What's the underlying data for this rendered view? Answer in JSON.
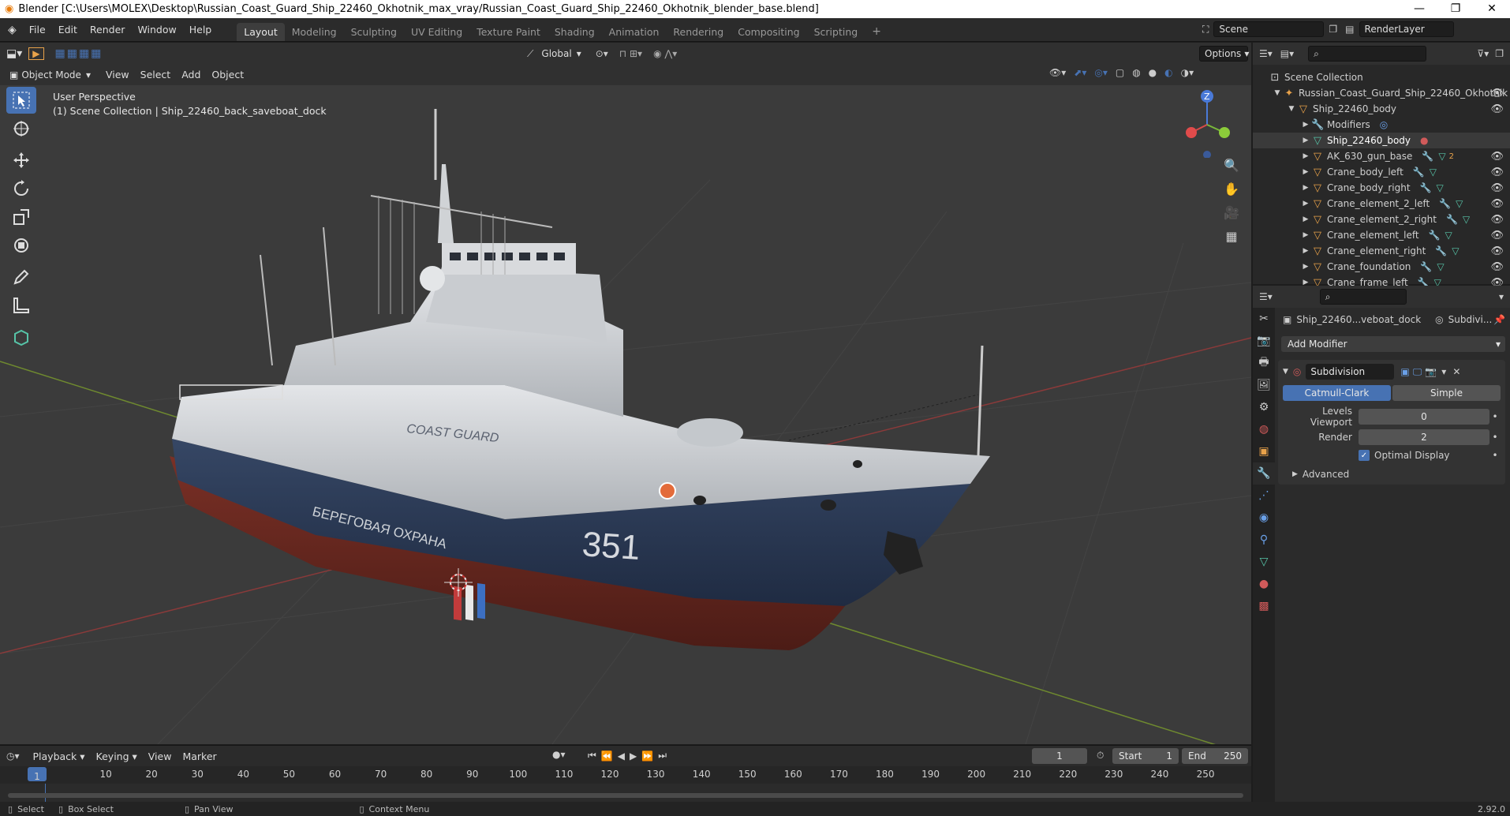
{
  "window": {
    "title": "Blender [C:\\Users\\MOLEX\\Desktop\\Russian_Coast_Guard_Ship_22460_Okhotnik_max_vray/Russian_Coast_Guard_Ship_22460_Okhotnik_blender_base.blend]",
    "min": "—",
    "max": "❐",
    "close": "✕"
  },
  "menu": [
    "File",
    "Edit",
    "Render",
    "Window",
    "Help"
  ],
  "workspaces": [
    "Layout",
    "Modeling",
    "Sculpting",
    "UV Editing",
    "Texture Paint",
    "Shading",
    "Animation",
    "Rendering",
    "Compositing",
    "Scripting"
  ],
  "scene": {
    "name": "Scene",
    "render_layer": "RenderLayer"
  },
  "viewport": {
    "mode": "Object Mode",
    "menus": [
      "View",
      "Select",
      "Add",
      "Object"
    ],
    "transform": "Global",
    "options": "Options",
    "perspective": "User Perspective",
    "collection_info": "(1) Scene Collection | Ship_22460_back_saveboat_dock",
    "hull_number": "351",
    "hull_text": "COAST GUARD",
    "side_text": "БЕРЕГОВАЯ ОХРАНА",
    "gizmo_z": "Z"
  },
  "outliner": {
    "root": "Scene Collection",
    "items": [
      {
        "label": "Russian_Coast_Guard_Ship_22460_Okhotnik",
        "depth": 1,
        "icon": "armature-icon",
        "color": "#e8a24a"
      },
      {
        "label": "Ship_22460_body",
        "depth": 2,
        "icon": "mesh-object-icon",
        "color": "#e8a24a"
      },
      {
        "label": "Modifiers",
        "depth": 3,
        "icon": "wrench-icon",
        "color": "#6aa0e8"
      },
      {
        "label": "Ship_22460_body",
        "depth": 3,
        "icon": "mesh-data-icon",
        "color": "#57c4a8"
      },
      {
        "label": "AK_630_gun_base",
        "depth": 3,
        "icon": "mesh-object-icon",
        "color": "#e8a24a"
      },
      {
        "label": "Crane_body_left",
        "depth": 3,
        "icon": "mesh-object-icon",
        "color": "#e8a24a"
      },
      {
        "label": "Crane_body_right",
        "depth": 3,
        "icon": "mesh-object-icon",
        "color": "#e8a24a"
      },
      {
        "label": "Crane_element_2_left",
        "depth": 3,
        "icon": "mesh-object-icon",
        "color": "#e8a24a"
      },
      {
        "label": "Crane_element_2_right",
        "depth": 3,
        "icon": "mesh-object-icon",
        "color": "#e8a24a"
      },
      {
        "label": "Crane_element_left",
        "depth": 3,
        "icon": "mesh-object-icon",
        "color": "#e8a24a"
      },
      {
        "label": "Crane_element_right",
        "depth": 3,
        "icon": "mesh-object-icon",
        "color": "#e8a24a"
      },
      {
        "label": "Crane_foundation",
        "depth": 3,
        "icon": "mesh-object-icon",
        "color": "#e8a24a"
      },
      {
        "label": "Crane_frame_left",
        "depth": 3,
        "icon": "mesh-object-icon",
        "color": "#e8a24a"
      }
    ],
    "gun_base_badge": "2"
  },
  "properties": {
    "object_name": "Ship_22460...veboat_dock",
    "modifier_short": "Subdivi...",
    "add_modifier": "Add Modifier",
    "modifier_name": "Subdivision",
    "mode_a": "Catmull-Clark",
    "mode_b": "Simple",
    "levels_label": "Levels Viewport",
    "levels_value": "0",
    "render_label": "Render",
    "render_value": "2",
    "optimal": "Optimal Display",
    "advanced": "Advanced"
  },
  "timeline": {
    "menus": [
      "Playback",
      "Keying",
      "View",
      "Marker"
    ],
    "current_frame": "1",
    "start_label": "Start",
    "start": "1",
    "end_label": "End",
    "end": "250",
    "ticks": [
      "10",
      "20",
      "30",
      "40",
      "50",
      "60",
      "70",
      "80",
      "90",
      "100",
      "110",
      "120",
      "130",
      "140",
      "150",
      "160",
      "170",
      "180",
      "190",
      "200",
      "210",
      "220",
      "230",
      "240",
      "250"
    ],
    "playhead": "1"
  },
  "status": {
    "select": "Select",
    "box_select": "Box Select",
    "pan_view": "Pan View",
    "context_menu": "Context Menu",
    "version": "2.92.0"
  },
  "colors": {
    "accent": "#4772b3",
    "hull_blue": "#2b3a55",
    "hull_red": "#6b2a22",
    "superstructure": "#cfd2d5"
  }
}
